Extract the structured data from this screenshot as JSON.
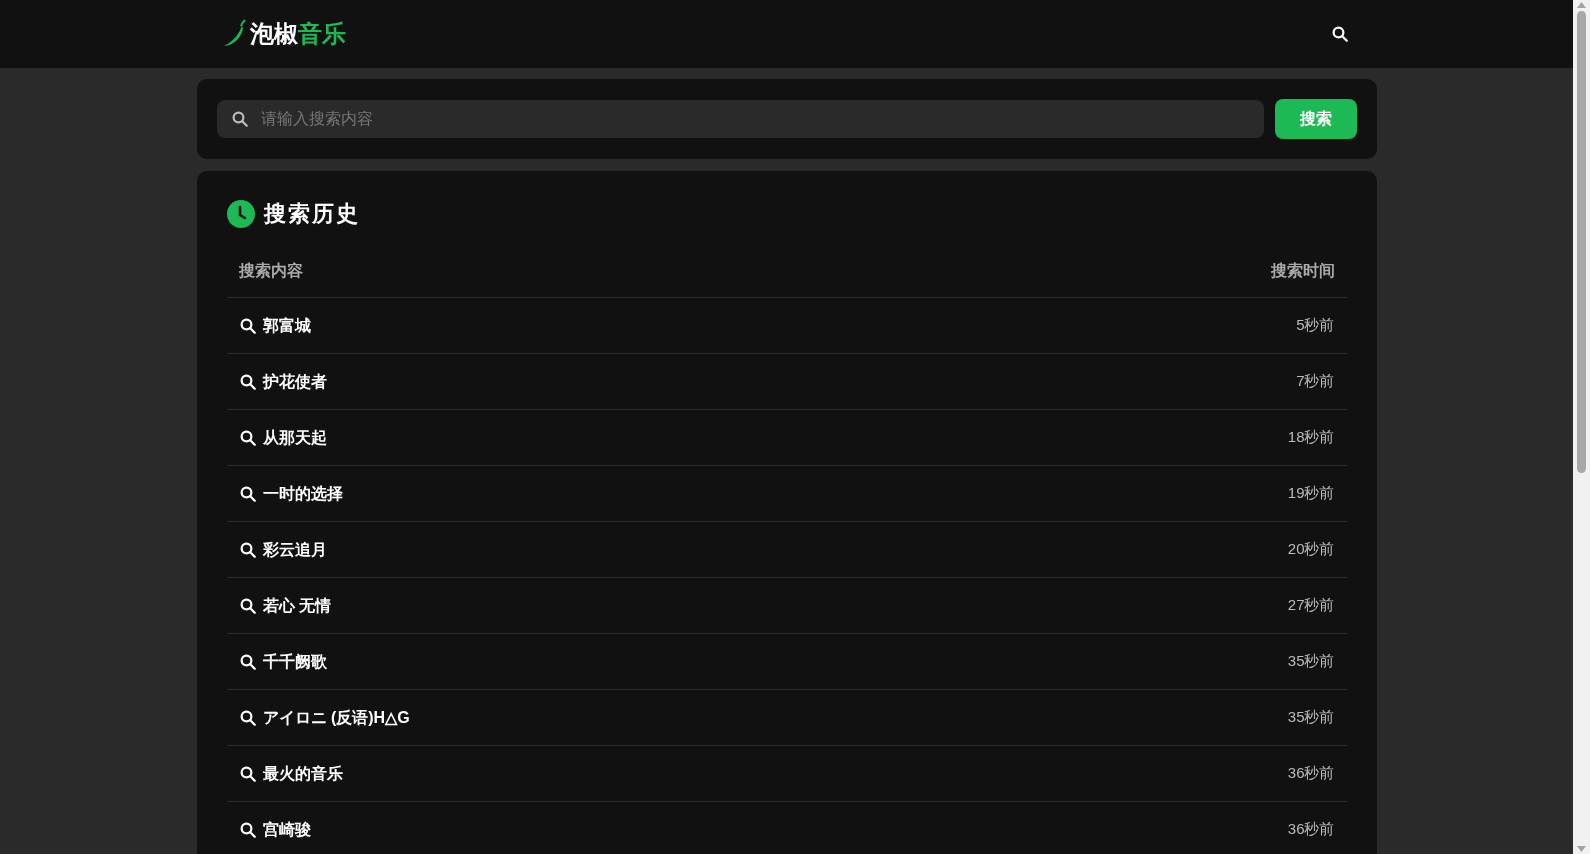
{
  "header": {
    "logo": {
      "part_1": "泡椒",
      "part_2": "音乐"
    }
  },
  "search": {
    "placeholder": "请输入搜索内容",
    "button": "搜索"
  },
  "history": {
    "title": "搜索历史",
    "columns": [
      "搜索内容",
      "搜索时间"
    ],
    "rows": [
      {
        "query": "郭富城",
        "time": "5秒前"
      },
      {
        "query": "护花使者",
        "time": "7秒前"
      },
      {
        "query": "从那天起",
        "time": "18秒前"
      },
      {
        "query": "一时的选择",
        "time": "19秒前"
      },
      {
        "query": "彩云追月",
        "time": "20秒前"
      },
      {
        "query": "若心 无情",
        "time": "27秒前"
      },
      {
        "query": "千千阙歌",
        "time": "35秒前"
      },
      {
        "query": "アイロニ (反语)H△G",
        "time": "35秒前"
      },
      {
        "query": "最火的音乐",
        "time": "36秒前"
      },
      {
        "query": "宫崎骏",
        "time": "36秒前"
      }
    ]
  }
}
